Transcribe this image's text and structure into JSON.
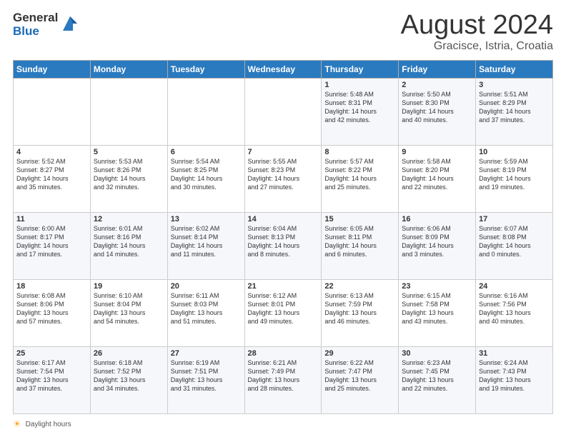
{
  "header": {
    "logo_general": "General",
    "logo_blue": "Blue",
    "month_title": "August 2024",
    "location": "Gracisce, Istria, Croatia"
  },
  "legend": {
    "text": "Daylight hours"
  },
  "weekdays": [
    "Sunday",
    "Monday",
    "Tuesday",
    "Wednesday",
    "Thursday",
    "Friday",
    "Saturday"
  ],
  "weeks": [
    [
      {
        "day": "",
        "info": ""
      },
      {
        "day": "",
        "info": ""
      },
      {
        "day": "",
        "info": ""
      },
      {
        "day": "",
        "info": ""
      },
      {
        "day": "1",
        "info": "Sunrise: 5:48 AM\nSunset: 8:31 PM\nDaylight: 14 hours\nand 42 minutes."
      },
      {
        "day": "2",
        "info": "Sunrise: 5:50 AM\nSunset: 8:30 PM\nDaylight: 14 hours\nand 40 minutes."
      },
      {
        "day": "3",
        "info": "Sunrise: 5:51 AM\nSunset: 8:29 PM\nDaylight: 14 hours\nand 37 minutes."
      }
    ],
    [
      {
        "day": "4",
        "info": "Sunrise: 5:52 AM\nSunset: 8:27 PM\nDaylight: 14 hours\nand 35 minutes."
      },
      {
        "day": "5",
        "info": "Sunrise: 5:53 AM\nSunset: 8:26 PM\nDaylight: 14 hours\nand 32 minutes."
      },
      {
        "day": "6",
        "info": "Sunrise: 5:54 AM\nSunset: 8:25 PM\nDaylight: 14 hours\nand 30 minutes."
      },
      {
        "day": "7",
        "info": "Sunrise: 5:55 AM\nSunset: 8:23 PM\nDaylight: 14 hours\nand 27 minutes."
      },
      {
        "day": "8",
        "info": "Sunrise: 5:57 AM\nSunset: 8:22 PM\nDaylight: 14 hours\nand 25 minutes."
      },
      {
        "day": "9",
        "info": "Sunrise: 5:58 AM\nSunset: 8:20 PM\nDaylight: 14 hours\nand 22 minutes."
      },
      {
        "day": "10",
        "info": "Sunrise: 5:59 AM\nSunset: 8:19 PM\nDaylight: 14 hours\nand 19 minutes."
      }
    ],
    [
      {
        "day": "11",
        "info": "Sunrise: 6:00 AM\nSunset: 8:17 PM\nDaylight: 14 hours\nand 17 minutes."
      },
      {
        "day": "12",
        "info": "Sunrise: 6:01 AM\nSunset: 8:16 PM\nDaylight: 14 hours\nand 14 minutes."
      },
      {
        "day": "13",
        "info": "Sunrise: 6:02 AM\nSunset: 8:14 PM\nDaylight: 14 hours\nand 11 minutes."
      },
      {
        "day": "14",
        "info": "Sunrise: 6:04 AM\nSunset: 8:13 PM\nDaylight: 14 hours\nand 8 minutes."
      },
      {
        "day": "15",
        "info": "Sunrise: 6:05 AM\nSunset: 8:11 PM\nDaylight: 14 hours\nand 6 minutes."
      },
      {
        "day": "16",
        "info": "Sunrise: 6:06 AM\nSunset: 8:09 PM\nDaylight: 14 hours\nand 3 minutes."
      },
      {
        "day": "17",
        "info": "Sunrise: 6:07 AM\nSunset: 8:08 PM\nDaylight: 14 hours\nand 0 minutes."
      }
    ],
    [
      {
        "day": "18",
        "info": "Sunrise: 6:08 AM\nSunset: 8:06 PM\nDaylight: 13 hours\nand 57 minutes."
      },
      {
        "day": "19",
        "info": "Sunrise: 6:10 AM\nSunset: 8:04 PM\nDaylight: 13 hours\nand 54 minutes."
      },
      {
        "day": "20",
        "info": "Sunrise: 6:11 AM\nSunset: 8:03 PM\nDaylight: 13 hours\nand 51 minutes."
      },
      {
        "day": "21",
        "info": "Sunrise: 6:12 AM\nSunset: 8:01 PM\nDaylight: 13 hours\nand 49 minutes."
      },
      {
        "day": "22",
        "info": "Sunrise: 6:13 AM\nSunset: 7:59 PM\nDaylight: 13 hours\nand 46 minutes."
      },
      {
        "day": "23",
        "info": "Sunrise: 6:15 AM\nSunset: 7:58 PM\nDaylight: 13 hours\nand 43 minutes."
      },
      {
        "day": "24",
        "info": "Sunrise: 6:16 AM\nSunset: 7:56 PM\nDaylight: 13 hours\nand 40 minutes."
      }
    ],
    [
      {
        "day": "25",
        "info": "Sunrise: 6:17 AM\nSunset: 7:54 PM\nDaylight: 13 hours\nand 37 minutes."
      },
      {
        "day": "26",
        "info": "Sunrise: 6:18 AM\nSunset: 7:52 PM\nDaylight: 13 hours\nand 34 minutes."
      },
      {
        "day": "27",
        "info": "Sunrise: 6:19 AM\nSunset: 7:51 PM\nDaylight: 13 hours\nand 31 minutes."
      },
      {
        "day": "28",
        "info": "Sunrise: 6:21 AM\nSunset: 7:49 PM\nDaylight: 13 hours\nand 28 minutes."
      },
      {
        "day": "29",
        "info": "Sunrise: 6:22 AM\nSunset: 7:47 PM\nDaylight: 13 hours\nand 25 minutes."
      },
      {
        "day": "30",
        "info": "Sunrise: 6:23 AM\nSunset: 7:45 PM\nDaylight: 13 hours\nand 22 minutes."
      },
      {
        "day": "31",
        "info": "Sunrise: 6:24 AM\nSunset: 7:43 PM\nDaylight: 13 hours\nand 19 minutes."
      }
    ]
  ]
}
